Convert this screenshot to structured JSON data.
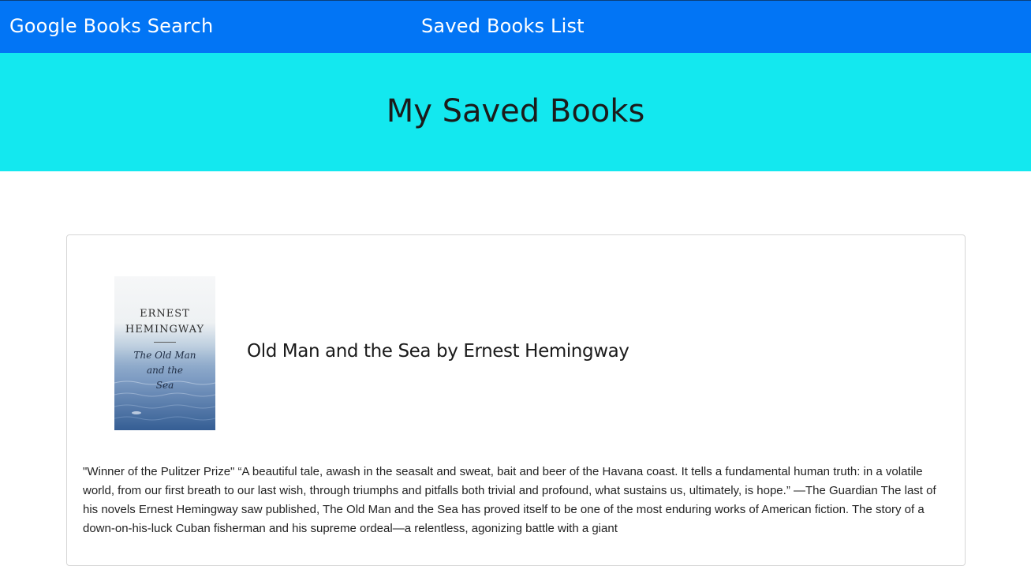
{
  "nav": {
    "search_link": "Google Books Search",
    "saved_link": "Saved Books List",
    "bg_color": "#0275f5"
  },
  "jumbotron": {
    "title": "My Saved Books",
    "bg_color": "#13e8ef"
  },
  "books": [
    {
      "cover": {
        "author_line1": "ERNEST",
        "author_line2": "HEMINGWAY",
        "title_line1": "The Old Man",
        "title_line2": "and the",
        "title_line3": "Sea"
      },
      "heading": "Old Man and the Sea by Ernest Hemingway",
      "description": "\"Winner of the Pulitzer Prize\" “A beautiful tale, awash in the seasalt and sweat, bait and beer of the Havana coast. It tells a fundamental human truth: in a volatile world, from our first breath to our last wish, through triumphs and pitfalls both trivial and profound, what sustains us, ultimately, is hope.” —The Guardian The last of his novels Ernest Hemingway saw published, The Old Man and the Sea has proved itself to be one of the most enduring works of American fiction. The story of a down-on-his-luck Cuban fisherman and his supreme ordeal—a relentless, agonizing battle with a giant"
    }
  ]
}
